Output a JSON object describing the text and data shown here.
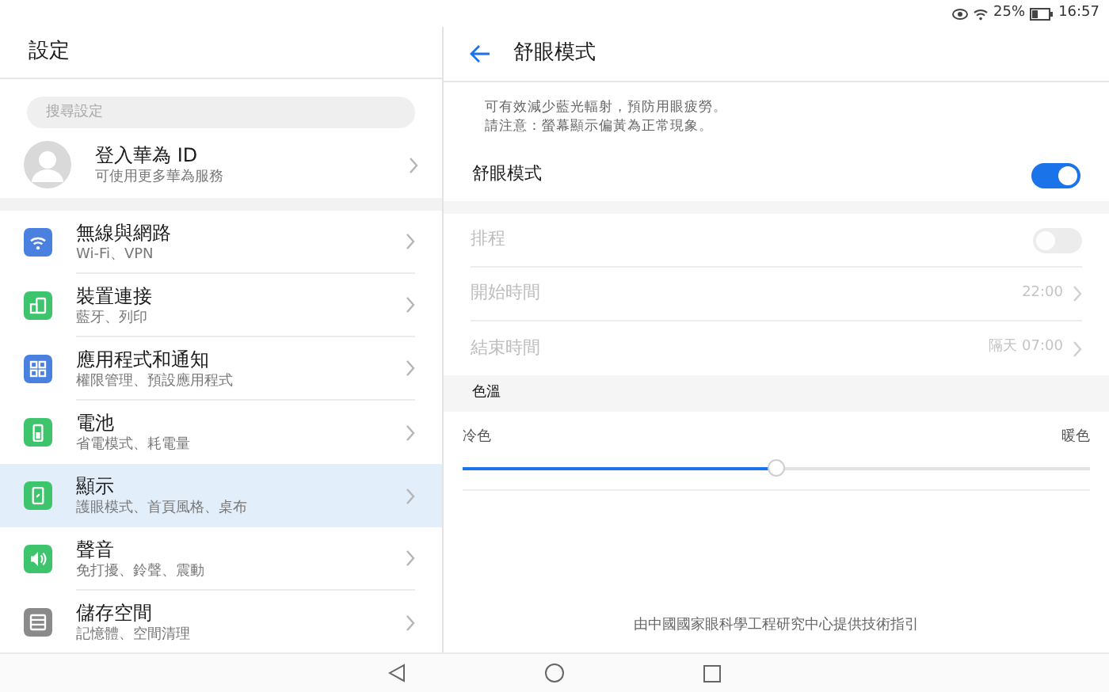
{
  "status_bar": {
    "battery": "25%",
    "time": "16:57"
  },
  "sidebar": {
    "title": "設定",
    "search": {
      "placeholder": "搜尋設定"
    },
    "account": {
      "title": "登入華為 ID",
      "subtitle": "可使用更多華為服務"
    },
    "items": [
      {
        "title": "無線與網路",
        "subtitle": "Wi-Fi、VPN",
        "color": "#4a80e0",
        "selected": false
      },
      {
        "title": "裝置連接",
        "subtitle": "藍牙、列印",
        "color": "#3ec46d",
        "selected": false
      },
      {
        "title": "應用程式和通知",
        "subtitle": "權限管理、預設應用程式",
        "color": "#4a80e0",
        "selected": false
      },
      {
        "title": "電池",
        "subtitle": "省電模式、耗電量",
        "color": "#3ec46d",
        "selected": false
      },
      {
        "title": "顯示",
        "subtitle": "護眼模式、首頁風格、桌布",
        "color": "#3ec46d",
        "selected": true
      },
      {
        "title": "聲音",
        "subtitle": "免打擾、鈴聲、震動",
        "color": "#3ec46d",
        "selected": false
      },
      {
        "title": "儲存空間",
        "subtitle": "記憶體、空間清理",
        "color": "#8a8a8a",
        "selected": false
      }
    ]
  },
  "detail": {
    "title": "舒眼模式",
    "description": [
      "可有效減少藍光輻射，預防用眼疲勞。",
      "請注意：螢幕顯示偏黃為正常現象。"
    ],
    "main_toggle": {
      "label": "舒眼模式",
      "on": true
    },
    "schedule": [
      {
        "kind": "toggle",
        "label": "排程",
        "on": false,
        "disabled": true
      },
      {
        "kind": "value",
        "label": "開始時間",
        "value": "22:00",
        "disabled": true
      },
      {
        "kind": "value",
        "label": "結束時間",
        "value": "隔天 07:00",
        "disabled": true
      }
    ],
    "temperature": {
      "heading": "色溫",
      "min_label": "冷色",
      "max_label": "暖色",
      "level": 0.5
    },
    "footer": "由中國國家眼科學工程研究中心提供技術指引"
  }
}
